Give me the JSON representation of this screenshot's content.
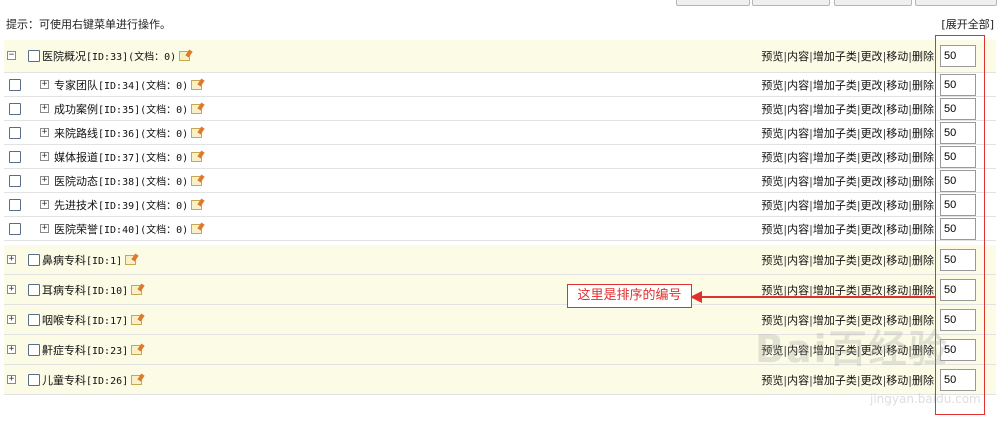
{
  "hint": "提示：可使用右键菜单进行操作。",
  "expand_all": "[展开全部]",
  "actions": {
    "preview": "预览",
    "content": "内容",
    "add_child": "增加子类",
    "edit": "更改",
    "move": "移动",
    "delete": "删除",
    "separator": "|"
  },
  "categories": [
    {
      "toggle": "−",
      "name": "医院概况",
      "code": "[ID:33](文档：0)",
      "order": "50"
    },
    {
      "toggle": "+",
      "name": "专家团队",
      "code": "[ID:34](文档：0)",
      "order": "50"
    },
    {
      "toggle": "+",
      "name": "成功案例",
      "code": "[ID:35](文档：0)",
      "order": "50"
    },
    {
      "toggle": "+",
      "name": "来院路线",
      "code": "[ID:36](文档：0)",
      "order": "50"
    },
    {
      "toggle": "+",
      "name": "媒体报道",
      "code": "[ID:37](文档：0)",
      "order": "50"
    },
    {
      "toggle": "+",
      "name": "医院动态",
      "code": "[ID:38](文档：0)",
      "order": "50"
    },
    {
      "toggle": "+",
      "name": "先进技术",
      "code": "[ID:39](文档：0)",
      "order": "50"
    },
    {
      "toggle": "+",
      "name": "医院荣誉",
      "code": "[ID:40](文档：0)",
      "order": "50"
    },
    {
      "toggle": "+",
      "name": "鼻病专科",
      "code": "[ID:1]",
      "order": "50"
    },
    {
      "toggle": "+",
      "name": "耳病专科",
      "code": "[ID:10]",
      "order": "50"
    },
    {
      "toggle": "+",
      "name": "咽喉专科",
      "code": "[ID:17]",
      "order": "50"
    },
    {
      "toggle": "+",
      "name": "鼾症专科",
      "code": "[ID:23]",
      "order": "50"
    },
    {
      "toggle": "+",
      "name": "儿童专科",
      "code": "[ID:26]",
      "order": "50"
    }
  ],
  "annotation": {
    "callout_text": "这里是排序的编号",
    "color": "#e03030"
  },
  "watermark": {
    "main": "Bai百经验",
    "sub": "jingyan.baidu.com"
  }
}
